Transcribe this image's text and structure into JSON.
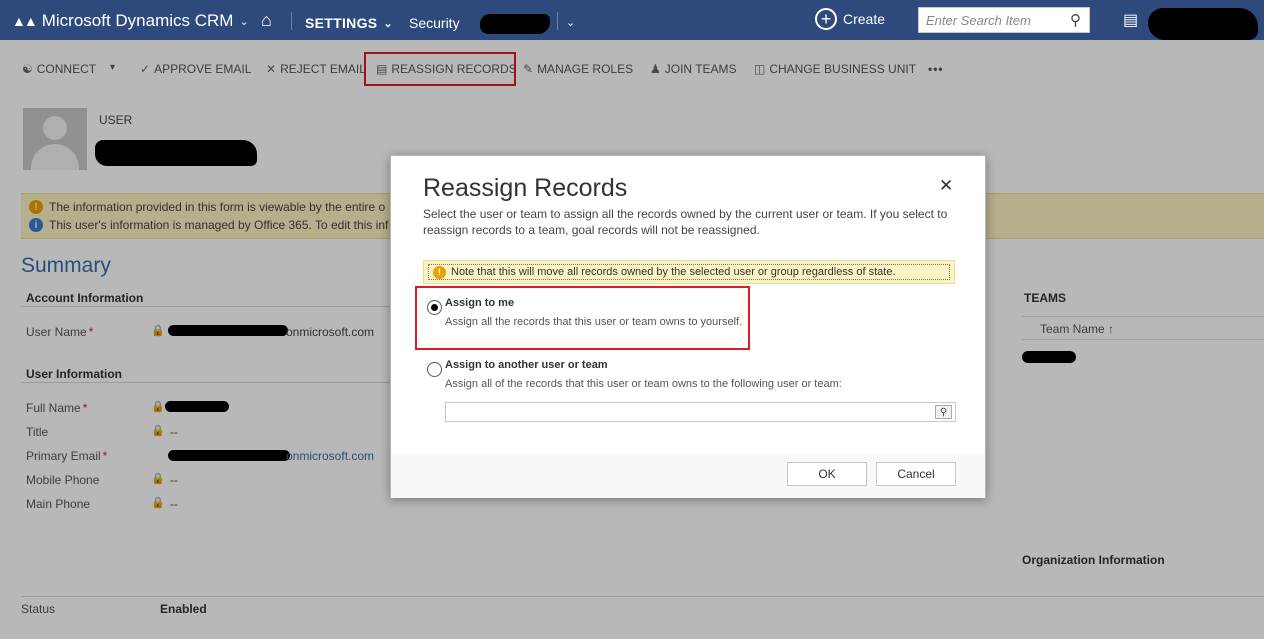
{
  "nav": {
    "app_title": "Microsoft Dynamics CRM",
    "area": "SETTINGS",
    "subarea": "Security",
    "create_label": "Create",
    "search_placeholder": "Enter Search Item"
  },
  "commands": [
    {
      "label": "CONNECT",
      "icon": "connect-icon"
    },
    {
      "label": "APPROVE EMAIL",
      "icon": "approve-email-icon"
    },
    {
      "label": "REJECT EMAIL",
      "icon": "reject-email-icon"
    },
    {
      "label": "REASSIGN RECORDS",
      "icon": "reassign-records-icon"
    },
    {
      "label": "MANAGE ROLES",
      "icon": "manage-roles-icon"
    },
    {
      "label": "JOIN TEAMS",
      "icon": "join-teams-icon"
    },
    {
      "label": "CHANGE BUSINESS UNIT",
      "icon": "change-business-unit-icon"
    },
    {
      "label": "•••",
      "icon": "more-commands-icon"
    }
  ],
  "form": {
    "entity_label": "USER",
    "notifications": [
      {
        "text": "The information provided in this form is viewable by the entire o",
        "color": "#e8a200"
      },
      {
        "text": "This user's information is managed by Office 365. To edit this inf",
        "color": "#3a7bd5"
      }
    ],
    "summary_title": "Summary",
    "account_section": "Account Information",
    "user_name_label": "User Name",
    "user_name_suffix": "onmicrosoft.com",
    "user_info_section": "User Information",
    "full_name_label": "Full Name",
    "title_label": "Title",
    "title_value": "--",
    "primary_email_label": "Primary Email",
    "primary_email_suffix": "onmicrosoft.com",
    "mobile_phone_label": "Mobile Phone",
    "mobile_phone_value": "--",
    "main_phone_label": "Main Phone",
    "main_phone_value": "--",
    "teams_title": "TEAMS",
    "teams_column": "Team Name ↑",
    "org_title": "Organization Information",
    "status_label": "Status",
    "status_value": "Enabled"
  },
  "dialog": {
    "title": "Reassign Records",
    "description": "Select the user or team to assign all the records owned by the current user or team. If you select to reassign records to a team, goal records will not be reassigned.",
    "warning": "Note that this will move all records owned by the selected user or group regardless of state.",
    "option1_title": "Assign to me",
    "option1_desc": "Assign all the records that this user or team owns to yourself.",
    "option2_title": "Assign to another user or team",
    "option2_desc": "Assign all of the records that this user or team owns to the following user or team:",
    "ok_label": "OK",
    "cancel_label": "Cancel"
  },
  "colors": {
    "nav_bg": "#2e4a7d",
    "highlight": "#e11b22",
    "warning_bg": "#fbf3c2"
  }
}
